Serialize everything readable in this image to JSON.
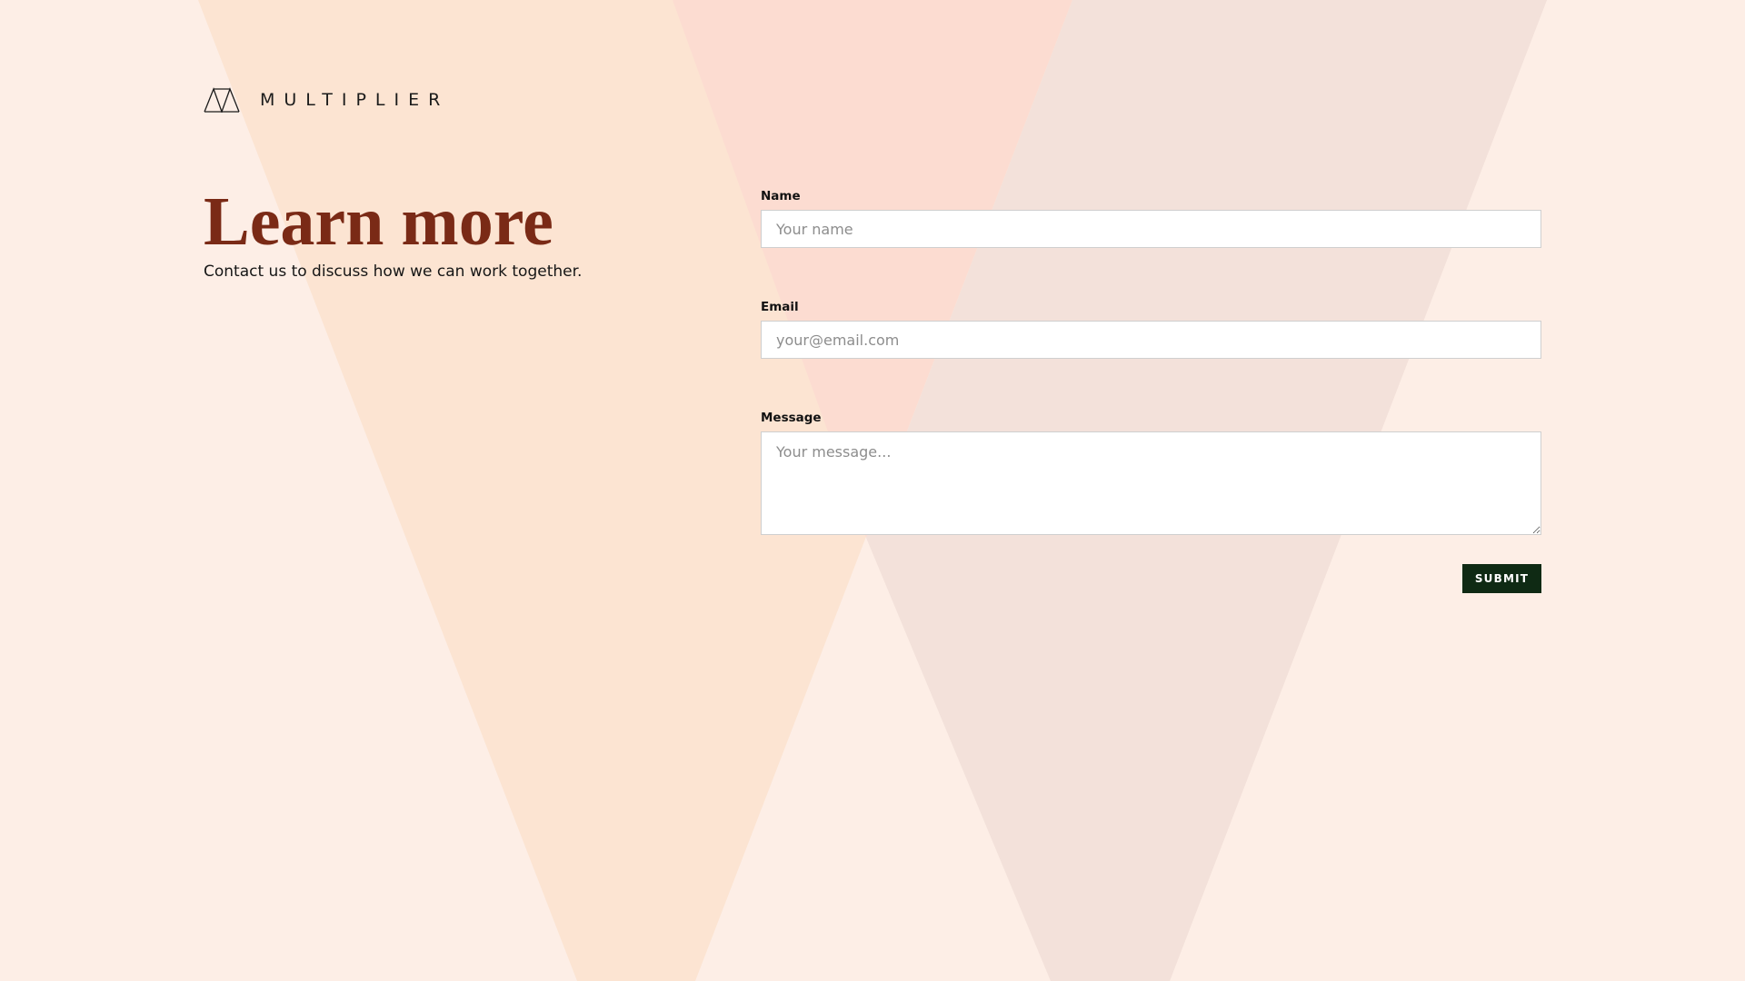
{
  "brand": {
    "name": "MULTIPLIER",
    "icon": "multiplier-logo-icon"
  },
  "hero": {
    "title": "Learn more",
    "subtitle": "Contact us to discuss how we can work together."
  },
  "form": {
    "name": {
      "label": "Name",
      "value": "",
      "placeholder": "Your name"
    },
    "email": {
      "label": "Email",
      "value": "",
      "placeholder": "your@email.com"
    },
    "message": {
      "label": "Message",
      "value": "",
      "placeholder": "Your message..."
    },
    "submit_label": "SUBMIT"
  },
  "colors": {
    "background": "#fdeee6",
    "heading": "#7a2a16",
    "button": "#0f2a14",
    "shape_peach": "#fce4d2",
    "shape_pink": "#fcdcd1",
    "shape_mauve": "#f3e1da"
  }
}
